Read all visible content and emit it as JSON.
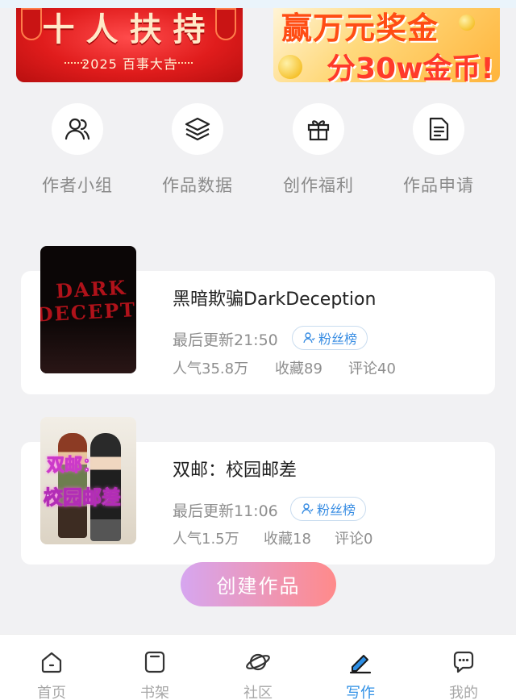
{
  "banners": {
    "left": {
      "headline": "十人扶持",
      "subline": "2025 百事大吉"
    },
    "right": {
      "line1": "赢万元奖金",
      "line2": "分30w金币!"
    }
  },
  "quick_actions": [
    {
      "label": "作者小组",
      "icon": "people-icon"
    },
    {
      "label": "作品数据",
      "icon": "layers-icon"
    },
    {
      "label": "创作福利",
      "icon": "gift-icon"
    },
    {
      "label": "作品申请",
      "icon": "document-icon"
    }
  ],
  "works": [
    {
      "cover_text": "DARK DECEPTION",
      "title": "黑暗欺骗DarkDeception",
      "last_update": "最后更新21:50",
      "fan_button": "粉丝榜",
      "popularity": "人气35.8万",
      "favorites": "收藏89",
      "comments": "评论40"
    },
    {
      "cover_text_1": "双邮：",
      "cover_text_2": "校园邮差",
      "title": "双邮：校园邮差",
      "last_update": "最后更新11:06",
      "fan_button": "粉丝榜",
      "popularity": "人气1.5万",
      "favorites": "收藏18",
      "comments": "评论0"
    }
  ],
  "create_button": "创建作品",
  "bottom_nav": [
    {
      "label": "首页",
      "icon": "home-icon"
    },
    {
      "label": "书架",
      "icon": "bookshelf-icon"
    },
    {
      "label": "社区",
      "icon": "planet-icon"
    },
    {
      "label": "写作",
      "icon": "pen-icon",
      "active": true
    },
    {
      "label": "我的",
      "icon": "chat-bubble-icon"
    }
  ],
  "colors": {
    "accent": "#2d8fe6",
    "background": "#f1f1f3",
    "create_gradient_start": "#d6a6f0",
    "create_gradient_end": "#ff8a8a"
  }
}
